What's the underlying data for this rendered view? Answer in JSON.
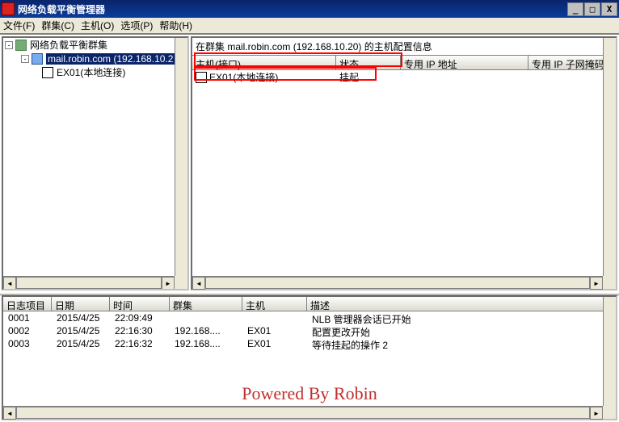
{
  "window": {
    "title": "网络负载平衡管理器",
    "min": "_",
    "max": "□",
    "close": "X"
  },
  "menu": {
    "file": "文件(F)",
    "cluster": "群集(C)",
    "host": "主机(O)",
    "options": "选项(P)",
    "help": "帮助(H)"
  },
  "tree": {
    "root": "网络负载平衡群集",
    "cluster": "mail.robin.com (192.168.10.2",
    "host": "EX01(本地连接)"
  },
  "rightPanel": {
    "title": "在群集 mail.robin.com (192.168.10.20) 的主机配置信息",
    "columns": {
      "host": "主机(接口)",
      "status": "状态",
      "ip": "专用 IP 地址",
      "mask": "专用 IP 子网掩码"
    },
    "rows": [
      {
        "host": "EX01(本地连接)",
        "status": "挂起",
        "ip": "",
        "mask": ""
      }
    ]
  },
  "log": {
    "columns": {
      "item": "日志项目",
      "date": "日期",
      "time": "时间",
      "cluster": "群集",
      "host": "主机",
      "desc": "描述"
    },
    "rows": [
      {
        "item": "0001",
        "date": "2015/4/25",
        "time": "22:09:49",
        "cluster": "",
        "host": "",
        "desc": "NLB 管理器会话已开始"
      },
      {
        "item": "0002",
        "date": "2015/4/25",
        "time": "22:16:30",
        "cluster": "192.168....",
        "host": "EX01",
        "desc": "配置更改开始"
      },
      {
        "item": "0003",
        "date": "2015/4/25",
        "time": "22:16:32",
        "cluster": "192.168....",
        "host": "EX01",
        "desc": "等待挂起的操作 2"
      }
    ]
  },
  "watermark": "Powered By Robin"
}
